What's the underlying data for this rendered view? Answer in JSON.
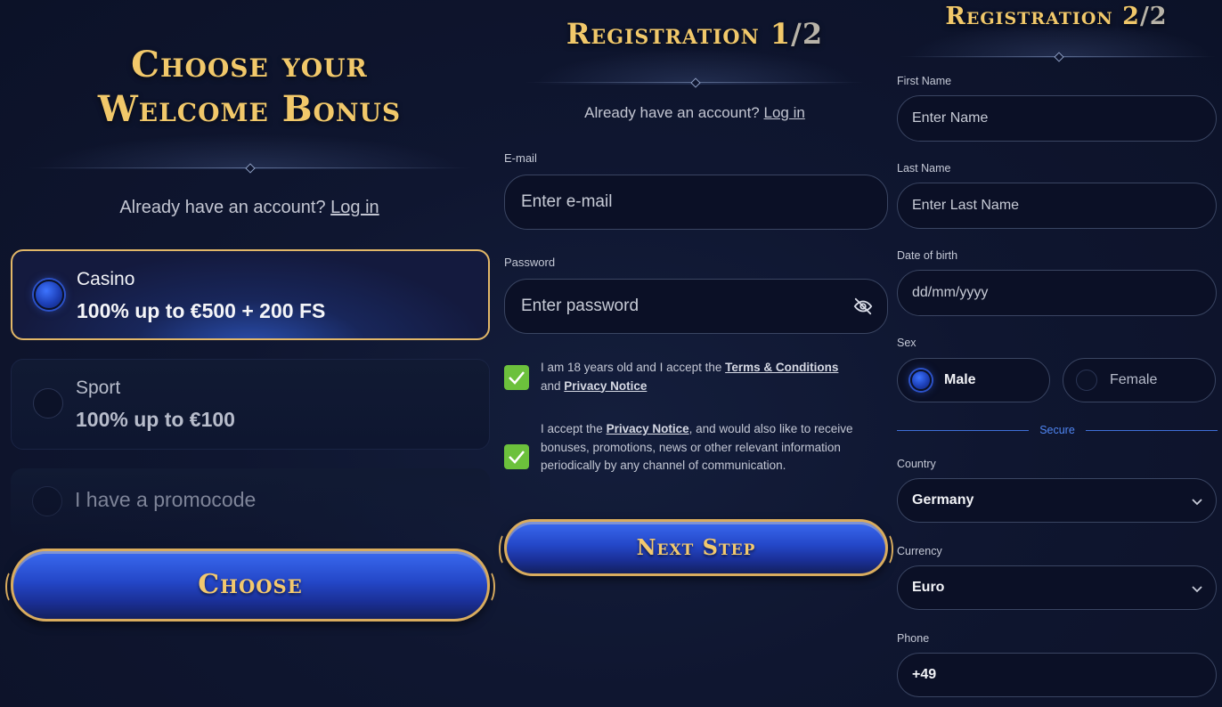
{
  "bonus_panel": {
    "title_line1": "Choose your",
    "title_line2": "Welcome Bonus",
    "login_prompt": "Already have an account?",
    "login_link": "Log in",
    "options": [
      {
        "line1": "Casino",
        "line2": "100% up to €500 + 200 FS",
        "selected": true
      },
      {
        "line1": "Sport",
        "line2": "100% up to €100",
        "selected": false
      }
    ],
    "promocode_label": "I have a promocode",
    "choose_button": "Choose"
  },
  "registration_step1": {
    "title_main": "Registration 1",
    "title_fraction": "/2",
    "login_prompt": "Already have an account?",
    "login_link": "Log in",
    "email": {
      "label": "E-mail",
      "placeholder": "Enter e-mail"
    },
    "password": {
      "label": "Password",
      "placeholder": "Enter password"
    },
    "consent1": {
      "prefix": "I am 18 years old and I accept the",
      "link1": "Terms & Conditions",
      "middle": "and",
      "link2": "Privacy Notice",
      "checked": true
    },
    "consent2": {
      "prefix": "I accept the",
      "link": "Privacy Notice",
      "suffix": ", and would also like to receive bonuses, promotions, news or other relevant information periodically by any channel of communication.",
      "checked": true
    },
    "next_button": "Next Step"
  },
  "registration_step2": {
    "title_main": "Registration 2",
    "title_fraction": "/2",
    "first_name": {
      "label": "First Name",
      "placeholder": "Enter Name"
    },
    "last_name": {
      "label": "Last Name",
      "placeholder": "Enter Last Name"
    },
    "dob": {
      "label": "Date of birth",
      "placeholder": "dd/mm/yyyy"
    },
    "sex": {
      "label": "Sex",
      "male": "Male",
      "female": "Female",
      "selected": "Male"
    },
    "secure_label": "Secure",
    "country": {
      "label": "Country",
      "value": "Germany"
    },
    "currency": {
      "label": "Currency",
      "value": "Euro"
    },
    "phone": {
      "label": "Phone",
      "value": "+49"
    }
  },
  "colors": {
    "gold": "#f1c86a",
    "accent_blue": "#2447c8",
    "check_green": "#6cc13c",
    "secure_blue": "#4f86f2"
  },
  "icons": [
    "eye-off-icon",
    "check-icon",
    "chevron-down-icon",
    "radio-icon"
  ]
}
